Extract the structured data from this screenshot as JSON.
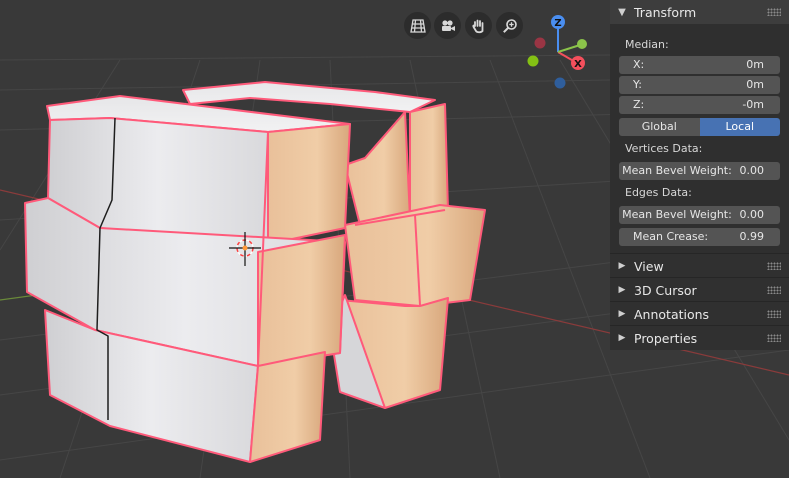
{
  "viewport": {
    "navigation": [
      {
        "name": "grid-view-icon"
      },
      {
        "name": "camera-view-icon"
      },
      {
        "name": "hand-pan-icon"
      },
      {
        "name": "zoom-icon"
      }
    ],
    "gizmo": {
      "z_label": "Z",
      "x_label": "X",
      "y_color": "#8bc34a",
      "x_color": "#f44f5c",
      "z_color": "#4a8ef0"
    }
  },
  "panel": {
    "transform": {
      "header": "Transform",
      "median_label": "Median:",
      "x": {
        "label": "X:",
        "value": "0m"
      },
      "y": {
        "label": "Y:",
        "value": "0m"
      },
      "z": {
        "label": "Z:",
        "value": "-0m"
      },
      "space": {
        "global": "Global",
        "local": "Local",
        "active": "Local"
      },
      "vertices_label": "Vertices Data:",
      "vertex_bevel": {
        "label": "Mean Bevel Weight:",
        "value": "0.00"
      },
      "edges_label": "Edges Data:",
      "edge_bevel": {
        "label": "Mean Bevel Weight:",
        "value": "0.00"
      },
      "edge_crease": {
        "label": "Mean Crease:",
        "value": "0.99"
      }
    },
    "sections": [
      "View",
      "3D Cursor",
      "Annotations",
      "Properties"
    ]
  },
  "colors": {
    "accent": "#4772b3",
    "selection": "#ff4f7a",
    "background": "#393939"
  }
}
